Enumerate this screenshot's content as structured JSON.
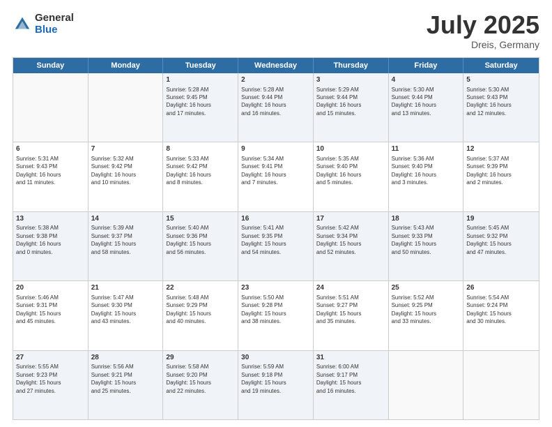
{
  "header": {
    "logo_general": "General",
    "logo_blue": "Blue",
    "title": "July 2025",
    "location": "Dreis, Germany"
  },
  "weekdays": [
    "Sunday",
    "Monday",
    "Tuesday",
    "Wednesday",
    "Thursday",
    "Friday",
    "Saturday"
  ],
  "weeks": [
    [
      {
        "day": "",
        "text": "",
        "empty": true
      },
      {
        "day": "",
        "text": "",
        "empty": true
      },
      {
        "day": "1",
        "text": "Sunrise: 5:28 AM\nSunset: 9:45 PM\nDaylight: 16 hours\nand 17 minutes."
      },
      {
        "day": "2",
        "text": "Sunrise: 5:28 AM\nSunset: 9:44 PM\nDaylight: 16 hours\nand 16 minutes."
      },
      {
        "day": "3",
        "text": "Sunrise: 5:29 AM\nSunset: 9:44 PM\nDaylight: 16 hours\nand 15 minutes."
      },
      {
        "day": "4",
        "text": "Sunrise: 5:30 AM\nSunset: 9:44 PM\nDaylight: 16 hours\nand 13 minutes."
      },
      {
        "day": "5",
        "text": "Sunrise: 5:30 AM\nSunset: 9:43 PM\nDaylight: 16 hours\nand 12 minutes."
      }
    ],
    [
      {
        "day": "6",
        "text": "Sunrise: 5:31 AM\nSunset: 9:43 PM\nDaylight: 16 hours\nand 11 minutes."
      },
      {
        "day": "7",
        "text": "Sunrise: 5:32 AM\nSunset: 9:42 PM\nDaylight: 16 hours\nand 10 minutes."
      },
      {
        "day": "8",
        "text": "Sunrise: 5:33 AM\nSunset: 9:42 PM\nDaylight: 16 hours\nand 8 minutes."
      },
      {
        "day": "9",
        "text": "Sunrise: 5:34 AM\nSunset: 9:41 PM\nDaylight: 16 hours\nand 7 minutes."
      },
      {
        "day": "10",
        "text": "Sunrise: 5:35 AM\nSunset: 9:40 PM\nDaylight: 16 hours\nand 5 minutes."
      },
      {
        "day": "11",
        "text": "Sunrise: 5:36 AM\nSunset: 9:40 PM\nDaylight: 16 hours\nand 3 minutes."
      },
      {
        "day": "12",
        "text": "Sunrise: 5:37 AM\nSunset: 9:39 PM\nDaylight: 16 hours\nand 2 minutes."
      }
    ],
    [
      {
        "day": "13",
        "text": "Sunrise: 5:38 AM\nSunset: 9:38 PM\nDaylight: 16 hours\nand 0 minutes."
      },
      {
        "day": "14",
        "text": "Sunrise: 5:39 AM\nSunset: 9:37 PM\nDaylight: 15 hours\nand 58 minutes."
      },
      {
        "day": "15",
        "text": "Sunrise: 5:40 AM\nSunset: 9:36 PM\nDaylight: 15 hours\nand 56 minutes."
      },
      {
        "day": "16",
        "text": "Sunrise: 5:41 AM\nSunset: 9:35 PM\nDaylight: 15 hours\nand 54 minutes."
      },
      {
        "day": "17",
        "text": "Sunrise: 5:42 AM\nSunset: 9:34 PM\nDaylight: 15 hours\nand 52 minutes."
      },
      {
        "day": "18",
        "text": "Sunrise: 5:43 AM\nSunset: 9:33 PM\nDaylight: 15 hours\nand 50 minutes."
      },
      {
        "day": "19",
        "text": "Sunrise: 5:45 AM\nSunset: 9:32 PM\nDaylight: 15 hours\nand 47 minutes."
      }
    ],
    [
      {
        "day": "20",
        "text": "Sunrise: 5:46 AM\nSunset: 9:31 PM\nDaylight: 15 hours\nand 45 minutes."
      },
      {
        "day": "21",
        "text": "Sunrise: 5:47 AM\nSunset: 9:30 PM\nDaylight: 15 hours\nand 43 minutes."
      },
      {
        "day": "22",
        "text": "Sunrise: 5:48 AM\nSunset: 9:29 PM\nDaylight: 15 hours\nand 40 minutes."
      },
      {
        "day": "23",
        "text": "Sunrise: 5:50 AM\nSunset: 9:28 PM\nDaylight: 15 hours\nand 38 minutes."
      },
      {
        "day": "24",
        "text": "Sunrise: 5:51 AM\nSunset: 9:27 PM\nDaylight: 15 hours\nand 35 minutes."
      },
      {
        "day": "25",
        "text": "Sunrise: 5:52 AM\nSunset: 9:25 PM\nDaylight: 15 hours\nand 33 minutes."
      },
      {
        "day": "26",
        "text": "Sunrise: 5:54 AM\nSunset: 9:24 PM\nDaylight: 15 hours\nand 30 minutes."
      }
    ],
    [
      {
        "day": "27",
        "text": "Sunrise: 5:55 AM\nSunset: 9:23 PM\nDaylight: 15 hours\nand 27 minutes."
      },
      {
        "day": "28",
        "text": "Sunrise: 5:56 AM\nSunset: 9:21 PM\nDaylight: 15 hours\nand 25 minutes."
      },
      {
        "day": "29",
        "text": "Sunrise: 5:58 AM\nSunset: 9:20 PM\nDaylight: 15 hours\nand 22 minutes."
      },
      {
        "day": "30",
        "text": "Sunrise: 5:59 AM\nSunset: 9:18 PM\nDaylight: 15 hours\nand 19 minutes."
      },
      {
        "day": "31",
        "text": "Sunrise: 6:00 AM\nSunset: 9:17 PM\nDaylight: 15 hours\nand 16 minutes."
      },
      {
        "day": "",
        "text": "",
        "empty": true
      },
      {
        "day": "",
        "text": "",
        "empty": true
      }
    ]
  ],
  "alt_rows": [
    0,
    2,
    4
  ]
}
